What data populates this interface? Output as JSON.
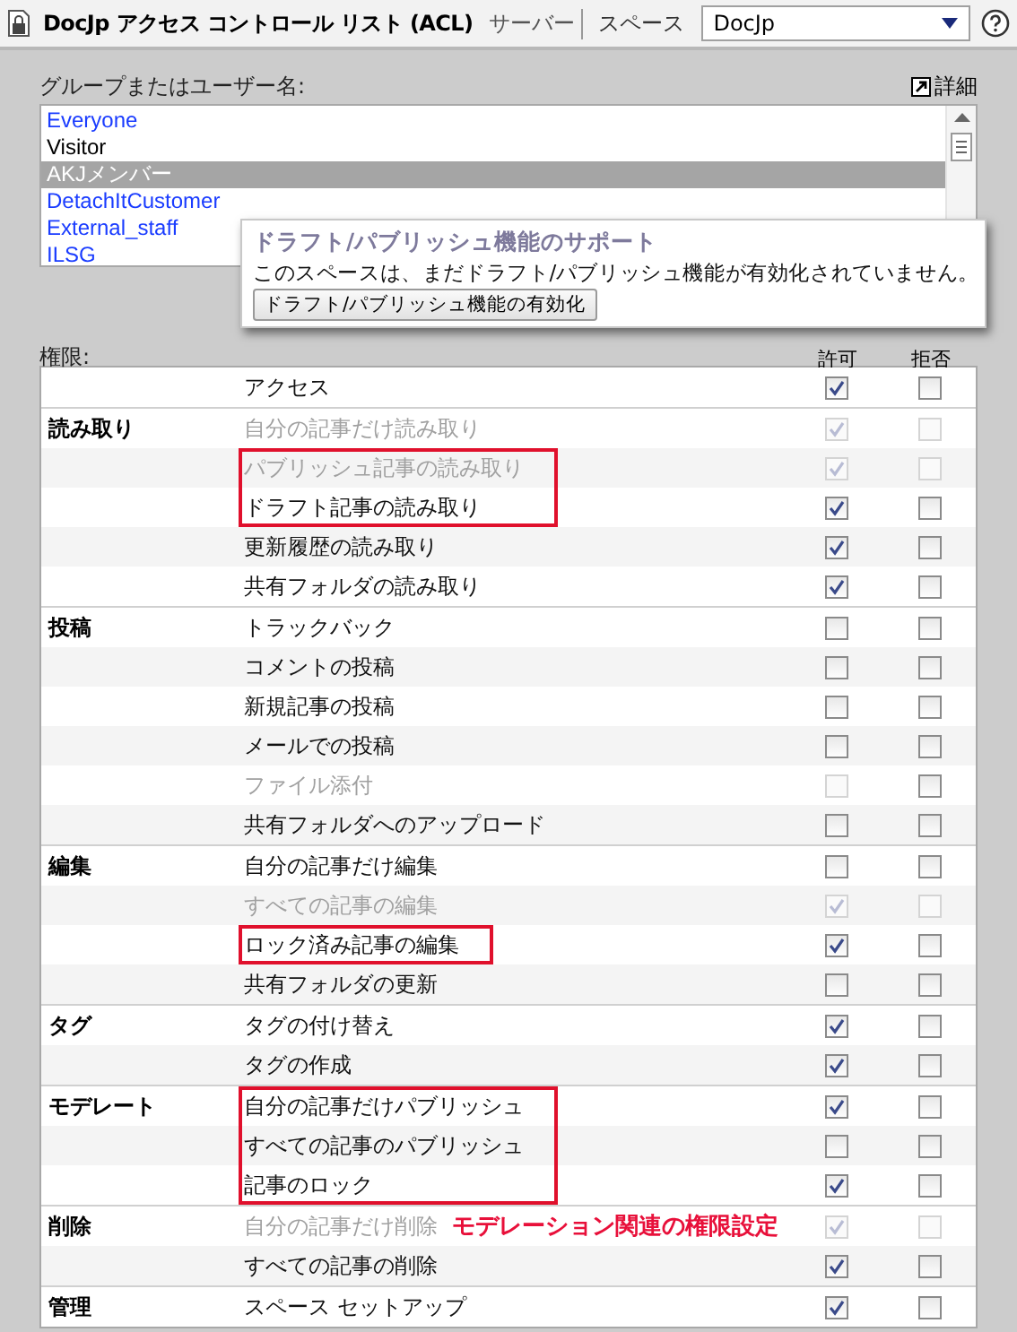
{
  "header": {
    "title": "DocJp アクセス コントロール リスト (ACL)",
    "tabs": [
      {
        "label": "サーバー",
        "selected": false
      },
      {
        "label": "スペース",
        "selected": true
      }
    ],
    "space_select": {
      "value": "DocJp"
    }
  },
  "users": {
    "label": "グループまたはユーザー名:",
    "details_link": "詳細",
    "items": [
      {
        "name": "Everyone",
        "color": "#1a3cff",
        "selected": false
      },
      {
        "name": "Visitor",
        "color": "#000000",
        "selected": false
      },
      {
        "name": "AKJメンバー",
        "selected": true
      },
      {
        "name": "DetachItCustomer",
        "color": "#1a3cff",
        "selected": false
      },
      {
        "name": "External_staff",
        "color": "#1a3cff",
        "selected": false
      },
      {
        "name": "ILSG",
        "color": "#1a3cff",
        "selected": false
      }
    ]
  },
  "popup": {
    "title": "ドラフト/パブリッシュ機能のサポート",
    "message": "このスペースは、まだドラフト/パブリッシュ機能が有効化されていません。",
    "button": "ドラフト/パブリッシュ機能の有効化"
  },
  "permissions": {
    "label": "権限:",
    "columns": [
      "許可",
      "拒否"
    ],
    "groups": [
      {
        "rows": [
          {
            "label": "アクセス",
            "disabled": false,
            "marked": false,
            "allow": {
              "checked": true,
              "disabled": false
            },
            "deny": {
              "checked": false,
              "disabled": false
            }
          }
        ]
      },
      {
        "category": "読み取り",
        "rows": [
          {
            "label": "自分の記事だけ読み取り",
            "disabled": true,
            "marked": false,
            "allow": {
              "checked": true,
              "disabled": true
            },
            "deny": {
              "checked": false,
              "disabled": true
            }
          },
          {
            "label": "パブリッシュ記事の読み取り",
            "disabled": true,
            "marked": true,
            "allow": {
              "checked": true,
              "disabled": true
            },
            "deny": {
              "checked": false,
              "disabled": true
            }
          },
          {
            "label": "ドラフト記事の読み取り",
            "disabled": false,
            "marked": true,
            "allow": {
              "checked": true,
              "disabled": false
            },
            "deny": {
              "checked": false,
              "disabled": false
            }
          },
          {
            "label": "更新履歴の読み取り",
            "disabled": false,
            "marked": false,
            "allow": {
              "checked": true,
              "disabled": false
            },
            "deny": {
              "checked": false,
              "disabled": false
            }
          },
          {
            "label": "共有フォルダの読み取り",
            "disabled": false,
            "marked": false,
            "allow": {
              "checked": true,
              "disabled": false
            },
            "deny": {
              "checked": false,
              "disabled": false
            }
          }
        ]
      },
      {
        "category": "投稿",
        "rows": [
          {
            "label": "トラックバック",
            "disabled": false,
            "marked": false,
            "allow": {
              "checked": false,
              "disabled": false
            },
            "deny": {
              "checked": false,
              "disabled": false
            }
          },
          {
            "label": "コメントの投稿",
            "disabled": false,
            "marked": false,
            "allow": {
              "checked": false,
              "disabled": false
            },
            "deny": {
              "checked": false,
              "disabled": false
            }
          },
          {
            "label": "新規記事の投稿",
            "disabled": false,
            "marked": false,
            "allow": {
              "checked": false,
              "disabled": false
            },
            "deny": {
              "checked": false,
              "disabled": false
            }
          },
          {
            "label": "メールでの投稿",
            "disabled": false,
            "marked": false,
            "allow": {
              "checked": false,
              "disabled": false
            },
            "deny": {
              "checked": false,
              "disabled": false
            }
          },
          {
            "label": "ファイル添付",
            "disabled": true,
            "marked": false,
            "allow": {
              "checked": false,
              "disabled": true
            },
            "deny": {
              "checked": false,
              "disabled": false
            }
          },
          {
            "label": "共有フォルダへのアップロード",
            "disabled": false,
            "marked": false,
            "allow": {
              "checked": false,
              "disabled": false
            },
            "deny": {
              "checked": false,
              "disabled": false
            }
          }
        ]
      },
      {
        "category": "編集",
        "rows": [
          {
            "label": "自分の記事だけ編集",
            "disabled": false,
            "marked": false,
            "allow": {
              "checked": false,
              "disabled": false
            },
            "deny": {
              "checked": false,
              "disabled": false
            }
          },
          {
            "label": "すべての記事の編集",
            "disabled": true,
            "marked": false,
            "allow": {
              "checked": true,
              "disabled": true
            },
            "deny": {
              "checked": false,
              "disabled": true
            }
          },
          {
            "label": "ロック済み記事の編集",
            "disabled": false,
            "marked": true,
            "allow": {
              "checked": true,
              "disabled": false
            },
            "deny": {
              "checked": false,
              "disabled": false
            }
          },
          {
            "label": "共有フォルダの更新",
            "disabled": false,
            "marked": false,
            "allow": {
              "checked": false,
              "disabled": false
            },
            "deny": {
              "checked": false,
              "disabled": false
            }
          }
        ]
      },
      {
        "category": "タグ",
        "rows": [
          {
            "label": "タグの付け替え",
            "disabled": false,
            "marked": false,
            "allow": {
              "checked": true,
              "disabled": false
            },
            "deny": {
              "checked": false,
              "disabled": false
            }
          },
          {
            "label": "タグの作成",
            "disabled": false,
            "marked": false,
            "allow": {
              "checked": true,
              "disabled": false
            },
            "deny": {
              "checked": false,
              "disabled": false
            }
          }
        ]
      },
      {
        "category": "モデレート",
        "rows": [
          {
            "label": "自分の記事だけパブリッシュ",
            "disabled": false,
            "marked": true,
            "allow": {
              "checked": true,
              "disabled": false
            },
            "deny": {
              "checked": false,
              "disabled": false
            }
          },
          {
            "label": "すべての記事のパブリッシュ",
            "disabled": false,
            "marked": true,
            "allow": {
              "checked": false,
              "disabled": false
            },
            "deny": {
              "checked": false,
              "disabled": false
            }
          },
          {
            "label": "記事のロック",
            "disabled": false,
            "marked": true,
            "allow": {
              "checked": true,
              "disabled": false
            },
            "deny": {
              "checked": false,
              "disabled": false
            }
          }
        ]
      },
      {
        "category": "削除",
        "rows": [
          {
            "label": "自分の記事だけ削除",
            "note": "モデレーション関連の権限設定",
            "disabled": true,
            "marked": false,
            "allow": {
              "checked": true,
              "disabled": true
            },
            "deny": {
              "checked": false,
              "disabled": true
            }
          },
          {
            "label": "すべての記事の削除",
            "disabled": false,
            "marked": false,
            "allow": {
              "checked": true,
              "disabled": false
            },
            "deny": {
              "checked": false,
              "disabled": false
            }
          }
        ]
      },
      {
        "category": "管理",
        "rows": [
          {
            "label": "スペース セットアップ",
            "disabled": false,
            "marked": false,
            "allow": {
              "checked": true,
              "disabled": false
            },
            "deny": {
              "checked": false,
              "disabled": false
            }
          }
        ]
      }
    ]
  }
}
